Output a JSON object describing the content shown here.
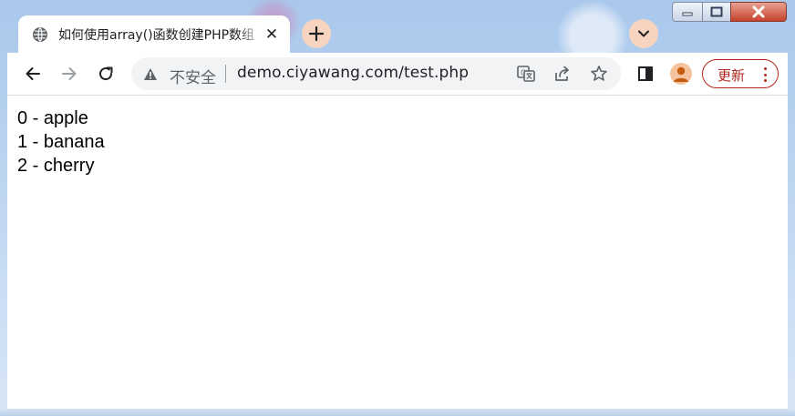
{
  "browser": {
    "tab": {
      "title": "如何使用array()函数创建PHP数组",
      "favicon": "globe-icon",
      "close_glyph": "✕"
    },
    "toolbar": {
      "insecure_label": "不安全",
      "url": "demo.ciyawang.com/test.php",
      "update_label": "更新"
    },
    "colors": {
      "accent_chip": "#f7d4c0",
      "update_red": "#b3261e",
      "profile": "#f4c39d"
    }
  },
  "page": {
    "items": [
      {
        "text": "0 - apple"
      },
      {
        "text": "1 - banana"
      },
      {
        "text": "2 - cherry"
      }
    ]
  }
}
